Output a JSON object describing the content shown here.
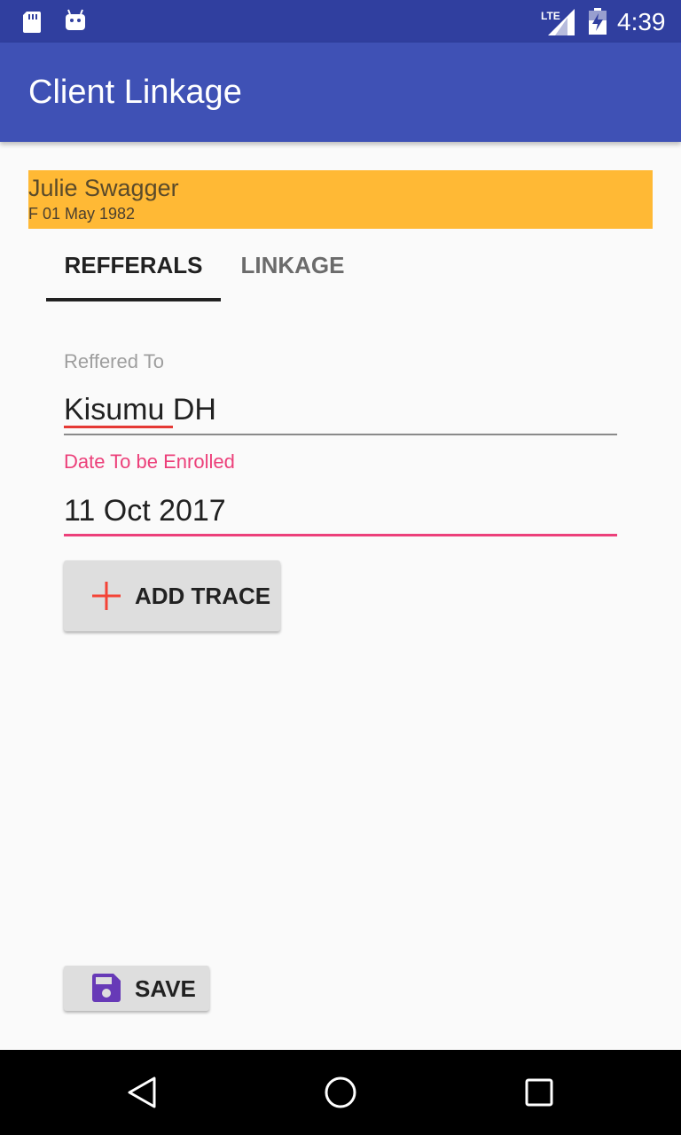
{
  "status_bar": {
    "time": "4:39",
    "network": "LTE",
    "icons": [
      "sd-card-icon",
      "android-debug-icon",
      "lte-signal-icon",
      "battery-icon"
    ]
  },
  "app_bar": {
    "title": "Client Linkage"
  },
  "client": {
    "name": "Julie  Swagger",
    "details": "F  01 May 1982",
    "banner_color": "#ffb935"
  },
  "tabs": [
    {
      "label": "REFFERALS",
      "selected": true
    },
    {
      "label": "LINKAGE",
      "selected": false
    }
  ],
  "form": {
    "referred_to": {
      "label": "Reffered To",
      "value": "Kisumu DH"
    },
    "date_enrolled": {
      "label": "Date To be Enrolled",
      "value": "11 Oct 2017"
    }
  },
  "buttons": {
    "add_trace": {
      "label": "ADD TRACE",
      "icon": "plus-icon"
    },
    "save": {
      "label": "SAVE",
      "icon": "floppy-disk-icon"
    }
  },
  "nav_bar": {
    "icons": [
      "back-icon",
      "home-icon",
      "recents-icon"
    ]
  },
  "colors": {
    "primary": "#3f51b5",
    "primary_dark": "#303f9f",
    "accent": "#ec407a",
    "banner": "#ffb935",
    "plus_icon": "#f44336",
    "save_icon": "#673ab7"
  }
}
